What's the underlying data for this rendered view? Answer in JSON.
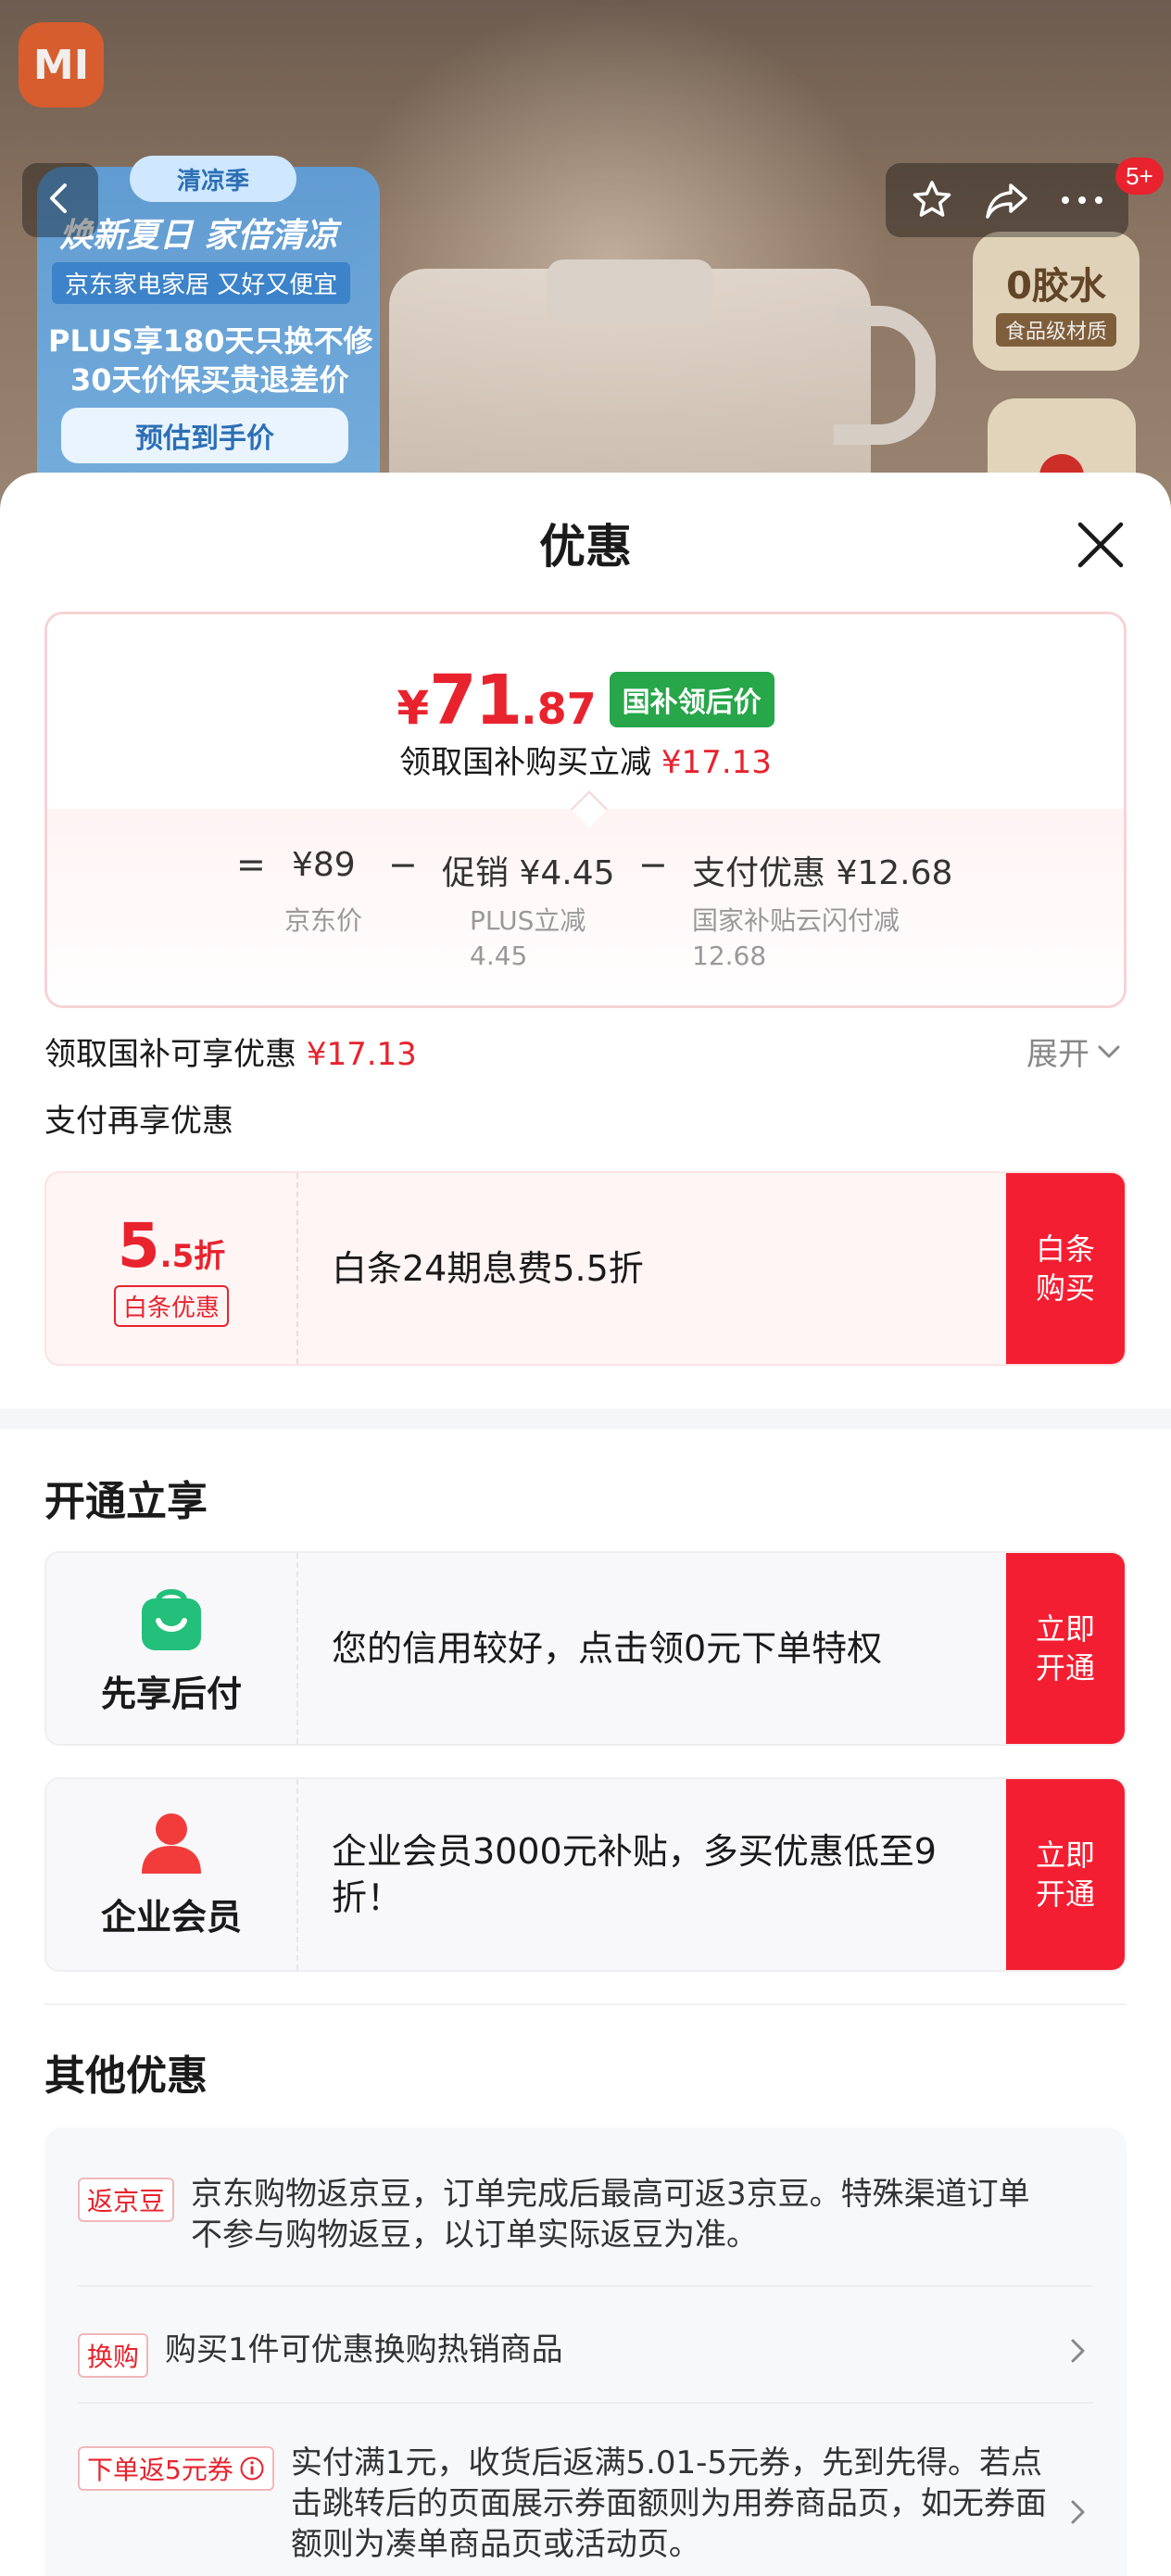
{
  "hero": {
    "logo_text": "MI",
    "promo_badge": "清凉季",
    "promo_line1": "焕新夏日 家倍清凉",
    "promo_line2": "京东家电家居 又好又便宜",
    "promo_line3": "PLUS享180天只换不修",
    "promo_line4": "30天价保买贵退差价",
    "promo_est": "预估到手价",
    "badge_big": "0胶水",
    "badge_small": "食品级材质",
    "message_count": "5+"
  },
  "sheet": {
    "title": "优惠"
  },
  "price": {
    "symbol": "¥",
    "integer": "71",
    "decimal": ".87",
    "tag": "国补领后价",
    "sub_label": "领取国补购买立减",
    "sub_amount": "¥17.13",
    "eq": "=",
    "base_value": "¥89",
    "base_label": "京东价",
    "minus1": "−",
    "promo_value": "促销 ¥4.45",
    "promo_label1": "PLUS立减",
    "promo_label2": "4.45",
    "minus2": "−",
    "pay_value": "支付优惠 ¥12.68",
    "pay_label1": "国家补贴云闪付减",
    "pay_label2": "12.68"
  },
  "subsidy_row": {
    "label": "领取国补可享优惠",
    "amount": "¥17.13",
    "expand": "展开"
  },
  "pay_more_label": "支付再享优惠",
  "baitiao": {
    "discount_num": "5",
    "discount_frac": ".5折",
    "tag": "白条优惠",
    "text": "白条24期息费5.5折",
    "button_line1": "白条",
    "button_line2": "购买"
  },
  "open_section": {
    "title": "开通立享",
    "cards": [
      {
        "label": "先享后付",
        "text": "您的信用较好，点击领0元下单特权",
        "button_line1": "立即",
        "button_line2": "开通"
      },
      {
        "label": "企业会员",
        "text": "企业会员3000元补贴，多买优惠低至9折！",
        "button_line1": "立即",
        "button_line2": "开通"
      }
    ]
  },
  "other_section": {
    "title": "其他优惠",
    "items": [
      {
        "tag": "返京豆",
        "text": "京东购物返京豆，订单完成后最高可返3京豆。特殊渠道订单不参与购物返豆，以订单实际返豆为准。"
      },
      {
        "tag": "换购",
        "text": "购买1件可优惠换购热销商品"
      },
      {
        "tag": "下单返5元券",
        "text": "实付满1元，收货后返满5.01-5元券，先到先得。若点击跳转后的页面展示券面额则为用券商品页，如无券面额则为凑单商品页或活动页。"
      }
    ]
  },
  "colors": {
    "accent_red": "#e8232e",
    "button_red": "#f41e32",
    "subsidy_green": "#27a64a"
  },
  "icons": [
    "back-arrow-icon",
    "star-icon",
    "share-icon",
    "more-icon",
    "close-icon",
    "chevron-down-icon",
    "shopping-bag-icon",
    "person-icon",
    "info-icon",
    "chevron-right-icon"
  ]
}
